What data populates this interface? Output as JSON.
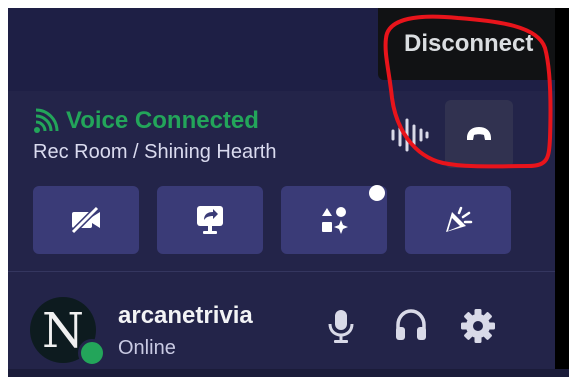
{
  "tooltip": {
    "text": "Disconnect"
  },
  "voice": {
    "status_label": "Voice Connected",
    "channel": "Rec Room / Shining Hearth",
    "status_color": "#23a55a"
  },
  "actions": [
    {
      "name": "camera-off",
      "icon": "video-off-icon"
    },
    {
      "name": "screen-share",
      "icon": "screen-share-icon"
    },
    {
      "name": "activities",
      "icon": "activities-icon",
      "notification_dot": true
    },
    {
      "name": "soundboard",
      "icon": "soundboard-icon"
    }
  ],
  "user": {
    "avatar_letter": "N",
    "username": "arcanetrivia",
    "status": "Online",
    "status_color": "#23a55a"
  },
  "controls": [
    "microphone-icon",
    "headphones-icon",
    "gear-icon"
  ],
  "colors": {
    "panel_bg": "#232449",
    "button_bg": "#3a3b77",
    "tooltip_bg": "#111214",
    "annotation": "#e8141b"
  }
}
